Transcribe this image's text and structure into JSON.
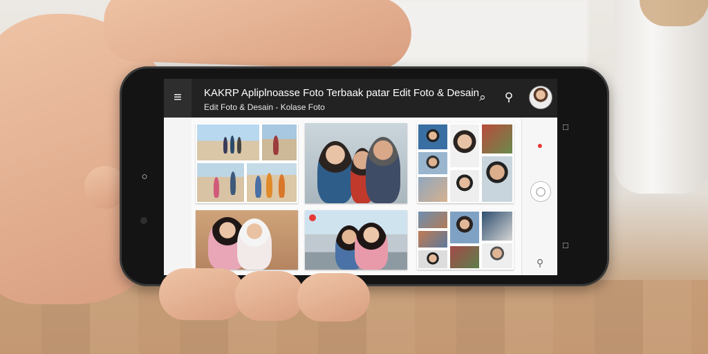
{
  "app": {
    "title": "KAKRP Apliplnoasse Foto Terbaak patar Edit Foto & Desain",
    "subtitle": "Edit Foto & Desain - Kolase Foto"
  },
  "toolbar": {
    "menu_icon": "≡",
    "search_icon": "⌕",
    "share_icon": "⚲"
  },
  "system_nav": {
    "back_icon": "◁",
    "home_icon": "○",
    "recents_icon": "○",
    "top_icon": "◌"
  },
  "right_rail": {
    "top_icon": "●",
    "mid_icon": "◯",
    "bottom_icon": "⚲"
  },
  "colors": {
    "appbar": "#222222",
    "screen_bg": "#f4f4f4",
    "accent_red": "#e53935",
    "accent_green": "#43a047",
    "accent_blue": "#1e88e5"
  },
  "collages": [
    {
      "label": "beach-collage"
    },
    {
      "label": "selfie-group-photo"
    },
    {
      "label": "portrait-grid-collage"
    },
    {
      "label": "two-women-photo"
    },
    {
      "label": "street-selfie-photo"
    },
    {
      "label": "family-grid-collage"
    }
  ]
}
